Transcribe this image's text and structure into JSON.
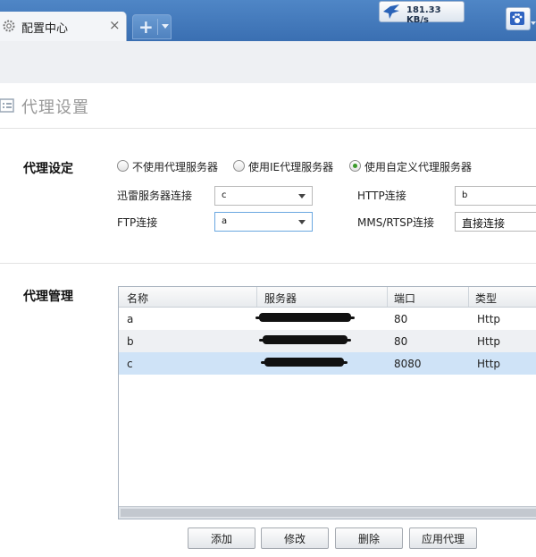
{
  "tab": {
    "title": "配置中心",
    "close_glyph": "×"
  },
  "toolbar": {
    "new_tab_glyph": "+",
    "speed": "181.33 KB/s"
  },
  "page": {
    "title": "代理设置"
  },
  "proxy_settings": {
    "section_label": "代理设定",
    "options": [
      {
        "label": "不使用代理服务器",
        "checked": false
      },
      {
        "label": "使用IE代理服务器",
        "checked": false
      },
      {
        "label": "使用自定义代理服务器",
        "checked": true
      }
    ],
    "fields": {
      "xunlei": {
        "label": "迅雷服务器连接",
        "value": "c"
      },
      "http": {
        "label": "HTTP连接",
        "value": "b"
      },
      "ftp": {
        "label": "FTP连接",
        "value": "a"
      },
      "mms": {
        "label": "MMS/RTSP连接",
        "value": "直接连接"
      }
    }
  },
  "proxy_management": {
    "section_label": "代理管理",
    "columns": [
      "名称",
      "服务器",
      "端口",
      "类型"
    ],
    "rows": [
      {
        "name": "a",
        "server": "",
        "port": "80",
        "type": "Http"
      },
      {
        "name": "b",
        "server": "",
        "port": "80",
        "type": "Http"
      },
      {
        "name": "c",
        "server": "",
        "port": "8080",
        "type": "Http"
      }
    ],
    "selected_row": 2
  },
  "buttons": {
    "add": "添加",
    "edit": "修改",
    "delete": "删除",
    "apply": "应用代理"
  },
  "colors": {
    "accent": "#3a6fb2",
    "selected_row": "#cfe3f7",
    "radio_checked": "#3a9a2a"
  }
}
